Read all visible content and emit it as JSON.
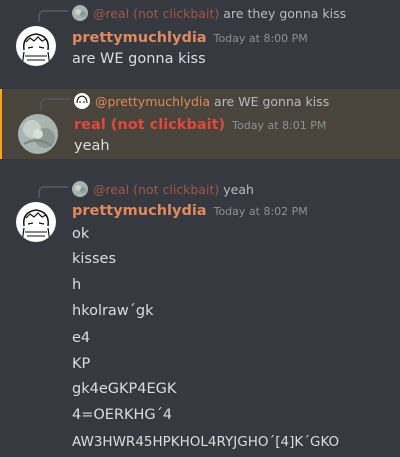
{
  "messages": [
    {
      "reply": {
        "author": "@real (not clickbait)",
        "text": "are they gonna kiss"
      },
      "author": "prettymuchlydia",
      "timestamp": "Today at 8:00 PM",
      "lines": [
        "are WE gonna kiss"
      ]
    },
    {
      "reply": {
        "author": "@prettymuchlydia",
        "text": "are WE gonna kiss"
      },
      "author": "real (not clickbait)",
      "timestamp": "Today at 8:01 PM",
      "lines": [
        "yeah"
      ]
    },
    {
      "reply": {
        "author": "@real (not clickbait)",
        "text": "yeah"
      },
      "author": "prettymuchlydia",
      "timestamp": "Today at 8:02 PM",
      "lines": [
        "ok",
        "kisses",
        "h",
        "hkolraw´gk",
        "e4",
        "KP",
        "gk4eGKP4EGK",
        "4=OERKHG´4",
        "AW3HWR45HPKHOL4RYJGHO´[4]K´GKO"
      ]
    }
  ],
  "colors": {
    "background": "#36393f",
    "mention_highlight": "#49443c",
    "mention_bar": "#faa61a",
    "username_orange": "#e08a5d",
    "username_red": "#e0483e",
    "text": "#dcddde",
    "timestamp": "#8e9297"
  }
}
